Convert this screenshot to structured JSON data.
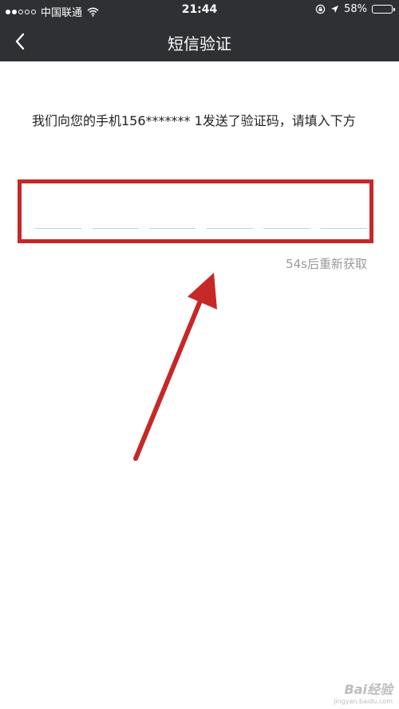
{
  "status_bar": {
    "carrier": "中国联通",
    "time": "21:44",
    "battery_percent": "58%",
    "battery_level": 0.58,
    "battery_color": "#4cd964"
  },
  "nav": {
    "title": "短信验证",
    "back_icon": "chevron-left-icon"
  },
  "content": {
    "instruction": "我们向您的手机156******* 1发送了验证码，请填入下方",
    "code_slots": 6,
    "resend_timer": "54s后重新获取"
  },
  "annotation": {
    "highlight_color": "#c62828"
  },
  "watermark": {
    "main": "Bai经验",
    "sub": "jingyan.baidu.com"
  },
  "colors": {
    "bar_background": "#2f3034",
    "page_background": "#ffffff",
    "timer_text": "#9a9a9a"
  }
}
